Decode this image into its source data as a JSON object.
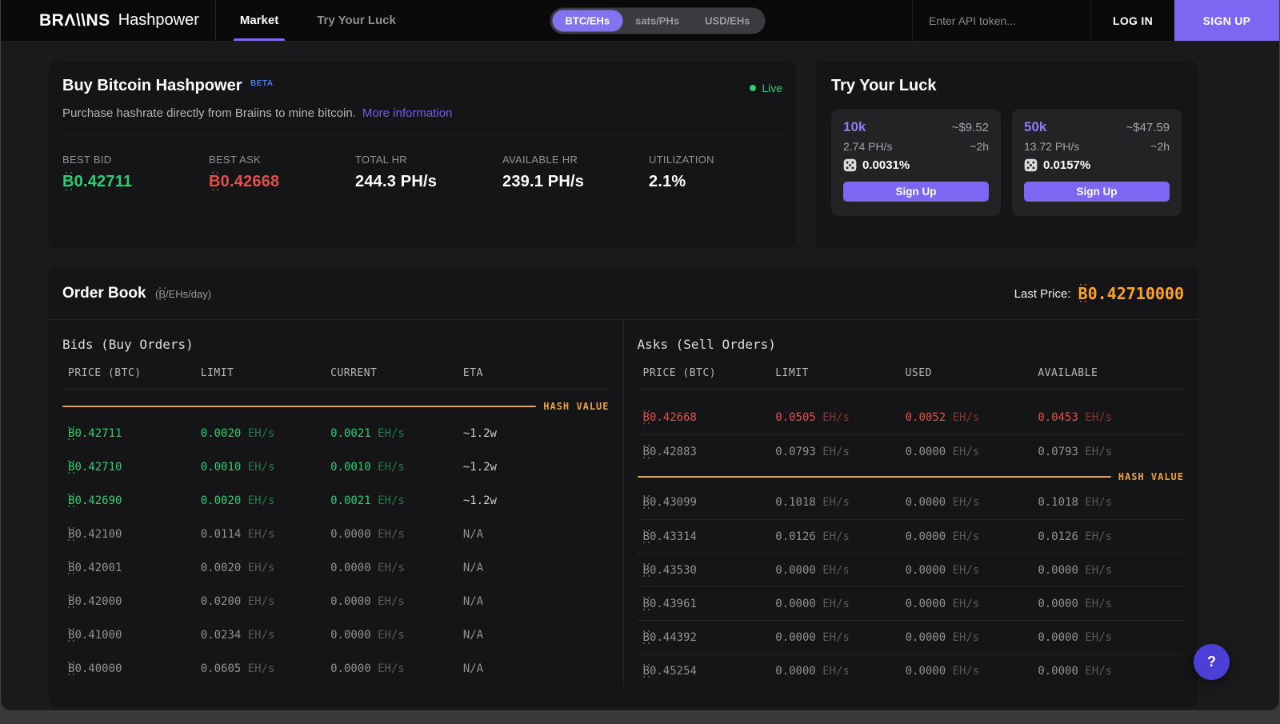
{
  "colors": {
    "accent_purple": "#7c66f2",
    "green": "#2ecc71",
    "red": "#e2504c",
    "orange": "#e8a23c",
    "orange_bright": "#ffa226"
  },
  "nav": {
    "brand": "BRΛ\\\\NS",
    "product": "Hashpower",
    "tabs": [
      {
        "label": "Market",
        "active": true
      },
      {
        "label": "Try Your Luck",
        "active": false
      }
    ],
    "currency_toggle": [
      {
        "label": "BTC/EHs",
        "active": true
      },
      {
        "label": "sats/PHs",
        "active": false
      },
      {
        "label": "USD/EHs",
        "active": false
      }
    ],
    "api_token_placeholder": "Enter API token...",
    "login_label": "LOG IN",
    "signup_label": "SIGN UP"
  },
  "buy_card": {
    "title": "Buy Bitcoin Hashpower",
    "beta_badge": "BETA",
    "live_label": "Live",
    "subtitle": "Purchase hashrate directly from Braiins to mine bitcoin.",
    "more_info_label": "More information",
    "stats": [
      {
        "label": "BEST BID",
        "value": "₿0.42711",
        "tone": "green"
      },
      {
        "label": "BEST ASK",
        "value": "₿0.42668",
        "tone": "red"
      },
      {
        "label": "TOTAL HR",
        "value": "244.3 PH/s",
        "tone": "white"
      },
      {
        "label": "AVAILABLE HR",
        "value": "239.1 PH/s",
        "tone": "white"
      },
      {
        "label": "UTILIZATION",
        "value": "2.1%",
        "tone": "white"
      }
    ]
  },
  "luck_card": {
    "title": "Try Your Luck",
    "offers": [
      {
        "name": "10k",
        "price": "~$9.52",
        "hashrate": "2.74 PH/s",
        "duration": "~2h",
        "chance": "0.0031%",
        "cta": "Sign Up"
      },
      {
        "name": "50k",
        "price": "~$47.59",
        "hashrate": "13.72 PH/s",
        "duration": "~2h",
        "chance": "0.0157%",
        "cta": "Sign Up"
      }
    ]
  },
  "order_book": {
    "title": "Order Book",
    "unit": "(₿/EHs/day)",
    "last_price_label": "Last Price:",
    "last_price_value": "₿0.42710000",
    "hash_value_label": "HASH VALUE",
    "bids": {
      "title": "Bids (Buy Orders)",
      "columns": [
        "PRICE (BTC)",
        "LIMIT",
        "CURRENT",
        "ETA"
      ],
      "hash_marker_index": 0,
      "rows": [
        {
          "tone": "green",
          "cells": [
            "₿0.42711",
            "0.0020 EH/s",
            "0.0021 EH/s",
            "~1.2w"
          ]
        },
        {
          "tone": "green",
          "cells": [
            "₿0.42710",
            "0.0010 EH/s",
            "0.0010 EH/s",
            "~1.2w"
          ]
        },
        {
          "tone": "green",
          "cells": [
            "₿0.42690",
            "0.0020 EH/s",
            "0.0021 EH/s",
            "~1.2w"
          ]
        },
        {
          "tone": "muted",
          "cells": [
            "₿0.42100",
            "0.0114 EH/s",
            "0.0000 EH/s",
            "N/A"
          ]
        },
        {
          "tone": "muted",
          "cells": [
            "₿0.42001",
            "0.0020 EH/s",
            "0.0000 EH/s",
            "N/A"
          ]
        },
        {
          "tone": "muted",
          "cells": [
            "₿0.42000",
            "0.0200 EH/s",
            "0.0000 EH/s",
            "N/A"
          ]
        },
        {
          "tone": "muted",
          "cells": [
            "₿0.41000",
            "0.0234 EH/s",
            "0.0000 EH/s",
            "N/A"
          ]
        },
        {
          "tone": "muted",
          "cells": [
            "₿0.40000",
            "0.0605 EH/s",
            "0.0000 EH/s",
            "N/A"
          ]
        }
      ]
    },
    "asks": {
      "title": "Asks (Sell Orders)",
      "columns": [
        "PRICE (BTC)",
        "LIMIT",
        "USED",
        "AVAILABLE"
      ],
      "hash_marker_index": 2,
      "rows": [
        {
          "tone": "red",
          "cells": [
            "₿0.42668",
            "0.0505 EH/s",
            "0.0052 EH/s",
            "0.0453 EH/s"
          ]
        },
        {
          "tone": "muted",
          "cells": [
            "₿0.42883",
            "0.0793 EH/s",
            "0.0000 EH/s",
            "0.0793 EH/s"
          ]
        },
        {
          "tone": "muted",
          "cells": [
            "₿0.43099",
            "0.1018 EH/s",
            "0.0000 EH/s",
            "0.1018 EH/s"
          ]
        },
        {
          "tone": "muted",
          "cells": [
            "₿0.43314",
            "0.0126 EH/s",
            "0.0000 EH/s",
            "0.0126 EH/s"
          ]
        },
        {
          "tone": "muted",
          "cells": [
            "₿0.43530",
            "0.0000 EH/s",
            "0.0000 EH/s",
            "0.0000 EH/s"
          ]
        },
        {
          "tone": "muted",
          "cells": [
            "₿0.43961",
            "0.0000 EH/s",
            "0.0000 EH/s",
            "0.0000 EH/s"
          ]
        },
        {
          "tone": "muted",
          "cells": [
            "₿0.44392",
            "0.0000 EH/s",
            "0.0000 EH/s",
            "0.0000 EH/s"
          ]
        },
        {
          "tone": "muted",
          "cells": [
            "₿0.45254",
            "0.0000 EH/s",
            "0.0000 EH/s",
            "0.0000 EH/s"
          ]
        }
      ]
    }
  },
  "help_button_label": "?"
}
